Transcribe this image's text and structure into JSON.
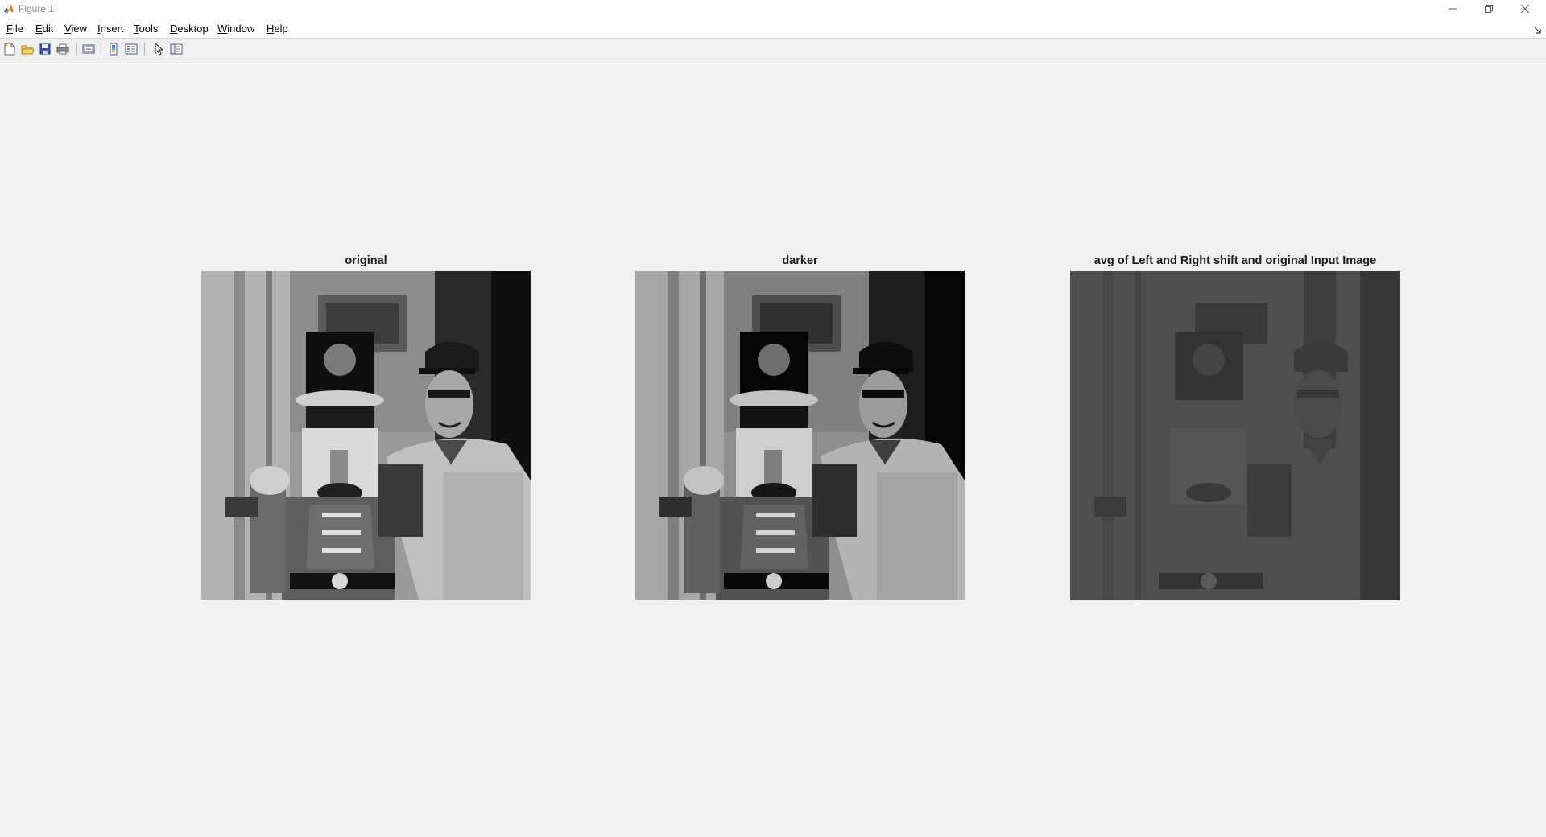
{
  "window": {
    "title": "Figure 1"
  },
  "menu": {
    "items": [
      {
        "label": "File"
      },
      {
        "label": "Edit"
      },
      {
        "label": "View"
      },
      {
        "label": "Insert"
      },
      {
        "label": "Tools"
      },
      {
        "label": "Desktop"
      },
      {
        "label": "Window"
      },
      {
        "label": "Help"
      }
    ]
  },
  "toolbar": {
    "buttons": [
      {
        "icon": "new-figure-icon"
      },
      {
        "icon": "open-file-icon"
      },
      {
        "icon": "save-icon"
      },
      {
        "icon": "print-icon"
      },
      {
        "icon": "link-plot-icon"
      },
      {
        "icon": "insert-colorbar-icon"
      },
      {
        "icon": "insert-legend-icon"
      },
      {
        "icon": "edit-plot-icon"
      },
      {
        "icon": "property-inspector-icon"
      }
    ]
  },
  "figure": {
    "axes": [
      {
        "title": "original",
        "image": "grayscale photo",
        "tone": "normal"
      },
      {
        "title": "darker",
        "image": "grayscale photo",
        "tone": "darker"
      },
      {
        "title": "avg of Left and Right shift and original Input Image",
        "image": "grayscale photo",
        "tone": "dark-low-contrast"
      }
    ]
  },
  "colors": {
    "background": "#f0f0f0",
    "titlebar": "#ffffff",
    "avg_image_gray": "#4f4f4f"
  }
}
